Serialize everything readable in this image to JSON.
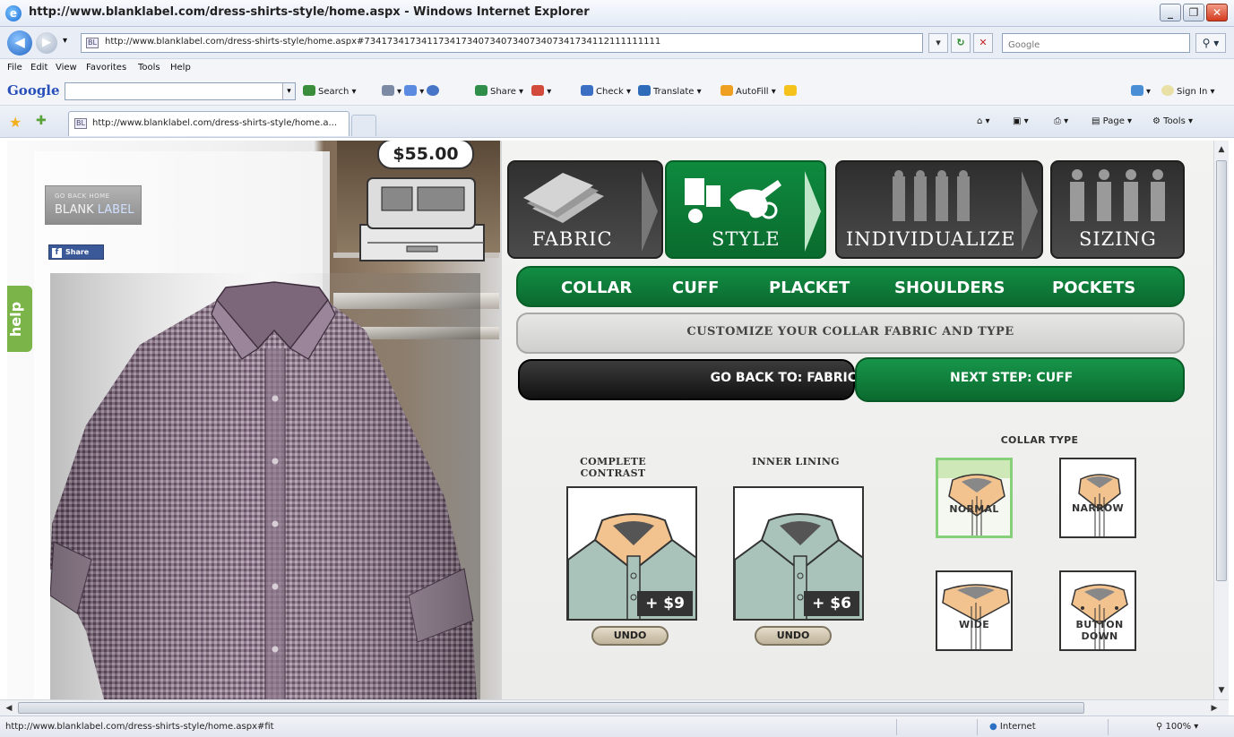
{
  "window": {
    "title": "http://www.blanklabel.com/dress-shirts-style/home.aspx - Windows Internet Explorer",
    "minimize": "_",
    "maximize": "❐",
    "close": "✕"
  },
  "address": {
    "back": "◀",
    "forward": "▶",
    "dropdown": "▾",
    "url": "http://www.blanklabel.com/dress-shirts-style/home.aspx#7341734173411734173407340734073407341734112111111111",
    "refresh": "↻",
    "stop": "✕",
    "search_placeholder": "Google",
    "search_go": "⚲ ▾"
  },
  "menu": [
    "File",
    "Edit",
    "View",
    "Favorites",
    "Tools",
    "Help"
  ],
  "google_toolbar": {
    "logo": "Google",
    "search": "Search",
    "share": "Share",
    "check": "Check",
    "translate": "Translate",
    "autofill": "AutoFill",
    "signin": "Sign In"
  },
  "tab": {
    "title": "http://www.blanklabel.com/dress-shirts-style/home.a...",
    "page": "Page",
    "tools": "Tools"
  },
  "page": {
    "price": "$55.00",
    "logo_small": "GO BACK HOME",
    "logo_brand_a": "BLANK ",
    "logo_brand_b": "LABEL",
    "share": "Share",
    "help": "help",
    "steps": [
      "FABRIC",
      "STYLE",
      "INDIVIDUALIZE",
      "SIZING"
    ],
    "active_step": "STYLE",
    "subtabs": [
      "COLLAR",
      "CUFF",
      "PLACKET",
      "SHOULDERS",
      "POCKETS"
    ],
    "instruction": "CUSTOMIZE YOUR COLLAR FABRIC AND TYPE",
    "go_back": "GO BACK TO: FABRIC",
    "next_step": "NEXT STEP: CUFF",
    "complete_contrast": {
      "title_line1": "COMPLETE",
      "title_line2": "CONTRAST",
      "price": "+ $9",
      "undo": "UNDO"
    },
    "inner_lining": {
      "title": "INNER LINING",
      "price": "+ $6",
      "undo": "UNDO"
    },
    "collar_type": {
      "title": "COLLAR TYPE",
      "options": [
        "NORMAL",
        "NARROW",
        "WIDE",
        "BUTTON DOWN"
      ],
      "selected": "NORMAL"
    },
    "colors": {
      "green": "#0b6a2f",
      "dark": "#2e2e2e",
      "collar": "#f2c38f",
      "shirt_contrast": "#a9c3bb"
    }
  },
  "status": {
    "url": "http://www.blanklabel.com/dress-shirts-style/home.aspx#fit",
    "zone": "Internet",
    "zoom": "100%"
  }
}
